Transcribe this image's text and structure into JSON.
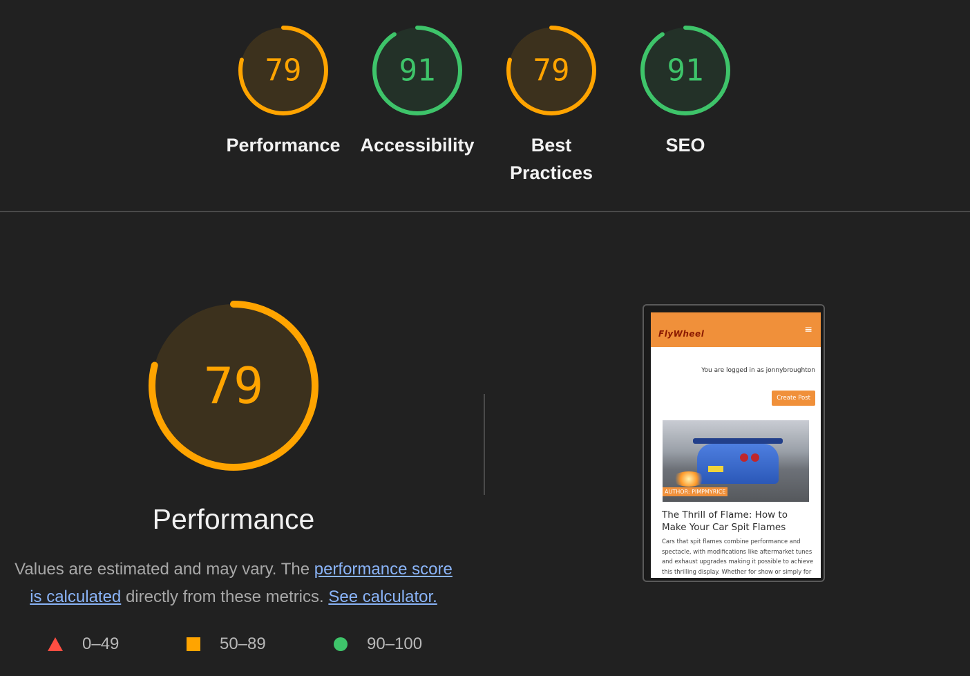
{
  "colors": {
    "average": "#ffa400",
    "pass": "#3ec46a",
    "fail": "#ff4e42",
    "link": "#8ab4f8"
  },
  "gauges": [
    {
      "score": "79",
      "label_lines": [
        "Performance"
      ],
      "status": "average",
      "value": 0.79
    },
    {
      "score": "91",
      "label_lines": [
        "Accessibility"
      ],
      "status": "pass",
      "value": 0.91
    },
    {
      "score": "79",
      "label_lines": [
        "Best",
        "Practices"
      ],
      "status": "average",
      "value": 0.79
    },
    {
      "score": "91",
      "label_lines": [
        "SEO"
      ],
      "status": "pass",
      "value": 0.91
    }
  ],
  "performance": {
    "score": "79",
    "value": 0.79,
    "title": "Performance",
    "desc_prefix": "Values are estimated and may vary. The ",
    "link_score": "performance score is calculated",
    "desc_mid": " directly from these metrics. ",
    "link_calc": "See calculator."
  },
  "legend": [
    {
      "range": "0–49",
      "shape": "triangle",
      "color": "#ff4e42"
    },
    {
      "range": "50–89",
      "shape": "square",
      "color": "#ffa400"
    },
    {
      "range": "90–100",
      "shape": "circle",
      "color": "#3ec46a"
    }
  ],
  "screenshot": {
    "logo": "FlyWheel",
    "menu_icon": "hamburger-icon",
    "logged_in": "You are logged in as jonnybroughton",
    "create_post": "Create Post",
    "author_tag": "AUTHOR: PIMPMYRICE",
    "post_title": "The Thrill of Flame: How to Make Your Car Spit Flames",
    "post_excerpt": "Cars that spit flames combine performance and spectacle, with modifications like aftermarket tunes and exhaust upgrades making it possible to achieve this thrilling display. Whether for show or simply for the love of speed, the"
  }
}
